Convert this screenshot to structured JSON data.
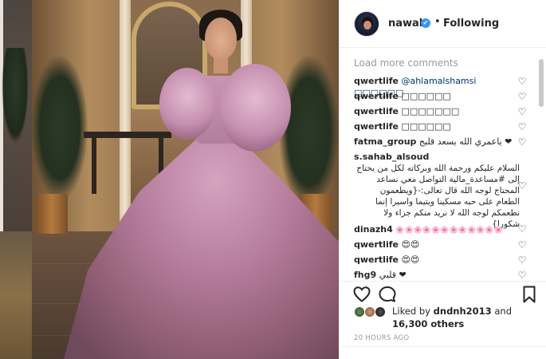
{
  "post": {
    "username": "nawal",
    "verified_mark": "✔",
    "separator": "•",
    "follow_status": "Following"
  },
  "comments": {
    "load_more": "Load more comments",
    "items": [
      {
        "user": "qwertlife",
        "text": "@ahlamalshamsi □□□□□□"
      },
      {
        "user": "qwertlife",
        "text": "□□□□□□"
      },
      {
        "user": "qwertlife",
        "text": "□□□□□□□"
      },
      {
        "user": "qwertlife",
        "text": "□□□□□□"
      },
      {
        "user": "fatma_group",
        "text": "ياعمري الله يسعد قلبج ❤"
      },
      {
        "user": "s.sahab_alsoud",
        "text": "السلام عليكم ورحمة الله وبركاته لكل من يحتاج إلى #مساعدة_مالية التواصل معي نساعد المحتاج لوجه الله قال تعالى:-{ويطعمون الطعام على حبه مسكينا ويتيما واسيرا إنما نطعمكم لوجه الله لا نريد منكم جزاء ولا شكورا}"
      },
      {
        "user": "dinazh4",
        "text": "🌸🌸🌸🌸🌸🌸🌸🌸🌸🌸🌸🌸"
      },
      {
        "user": "qwertlife",
        "text": "😍😍"
      },
      {
        "user": "qwertlife",
        "text": "😍😍"
      },
      {
        "user": "fhg9",
        "text": "قلبي ❤"
      }
    ]
  },
  "icons": {
    "heart": "heart-outline-icon",
    "comment": "comment-icon",
    "bookmark": "bookmark-icon",
    "like_glyph": "♡"
  },
  "likes": {
    "prefix": "Liked by",
    "user": "dndnh2013",
    "and": "and",
    "count": "16,300 others"
  },
  "timestamp": "20 HOURS AGO",
  "colors": {
    "link": "#003569",
    "verified": "#3897f0",
    "muted": "#999999"
  }
}
